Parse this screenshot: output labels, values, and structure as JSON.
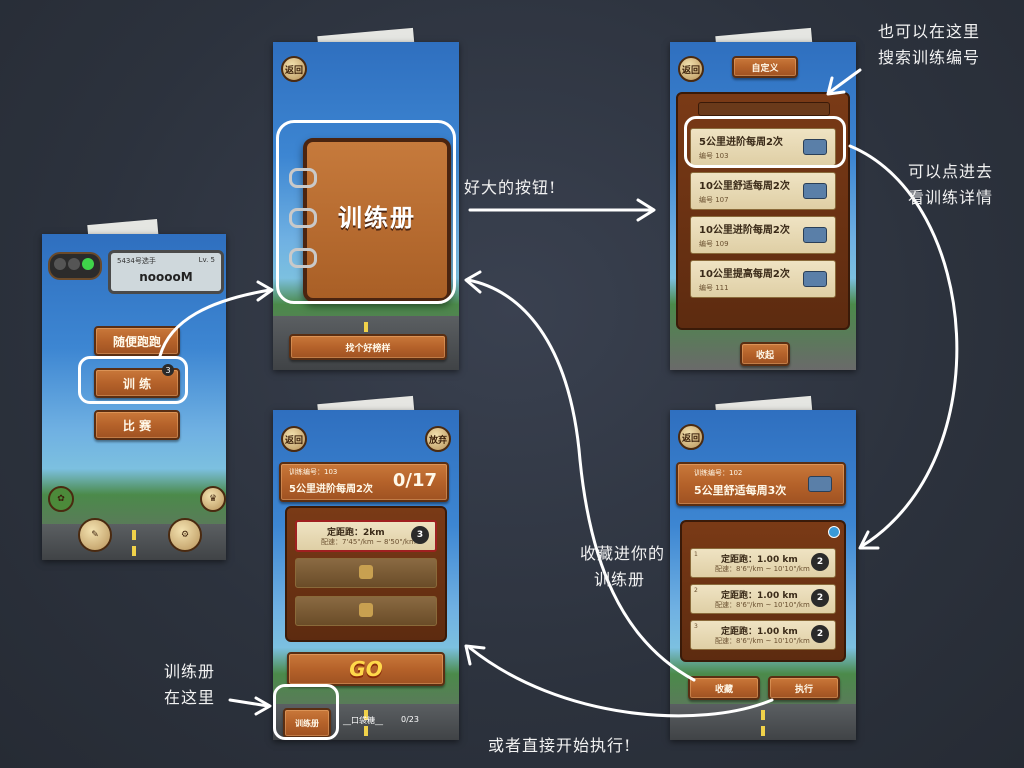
{
  "screen1": {
    "player_name_label": "5434号选手",
    "level": "Lv. 5",
    "nickname": "nooooM",
    "menu": [
      "随便跑跑",
      "训 练",
      "比 赛"
    ],
    "training_badge": "3"
  },
  "screen2": {
    "back_label": "返回",
    "book_title": "训练册",
    "bottom_label": "找个好榜样"
  },
  "screen3": {
    "back_label": "返回",
    "header_label": "自定义",
    "collapse_label": "收起",
    "plans": [
      {
        "title": "5公里进阶每周2次",
        "code": "编号 103"
      },
      {
        "title": "10公里舒适每周2次",
        "code": "编号 107"
      },
      {
        "title": "10公里进阶每周2次",
        "code": "编号 109"
      },
      {
        "title": "10公里提高每周2次",
        "code": "编号 111"
      }
    ]
  },
  "screen4": {
    "back_label": "返回",
    "give_up_label": "放弃",
    "plan_code": "训练编号：103",
    "plan_title": "5公里进阶每周2次",
    "progress": "0/17",
    "task_title": "定距跑：2km",
    "task_pace": "配速：7'45\"/km ~ 8'50\"/km",
    "task_badge": "3",
    "go_label": "GO",
    "book_label": "训练册",
    "footer_text": "__口袋糖__",
    "footer_progress": "0/23"
  },
  "screen5": {
    "back_label": "返回",
    "plan_code": "训练编号：102",
    "plan_title": "5公里舒适每周3次",
    "tasks": [
      {
        "title": "定距跑：1.00 km",
        "pace": "配速：8'6\"/km ~ 10'10\"/km",
        "num": "1",
        "badge": "2"
      },
      {
        "title": "定距跑：1.00 km",
        "pace": "配速：8'6\"/km ~ 10'10\"/km",
        "num": "2",
        "badge": "2"
      },
      {
        "title": "定距跑：1.00 km",
        "pace": "配速：8'6\"/km ~ 10'10\"/km",
        "num": "3",
        "badge": "2"
      }
    ],
    "collect_label": "收藏",
    "execute_label": "执行"
  },
  "notes": {
    "big_button": "好大的按钮!",
    "search_hint_1": "也可以在这里",
    "search_hint_2": "搜索训练编号",
    "detail_hint_1": "可以点进去",
    "detail_hint_2": "看训练详情",
    "collect_hint_1": "收藏进你的",
    "collect_hint_2": "训练册",
    "book_here_1": "训练册",
    "book_here_2": "在这里",
    "execute_hint": "或者直接开始执行!"
  }
}
